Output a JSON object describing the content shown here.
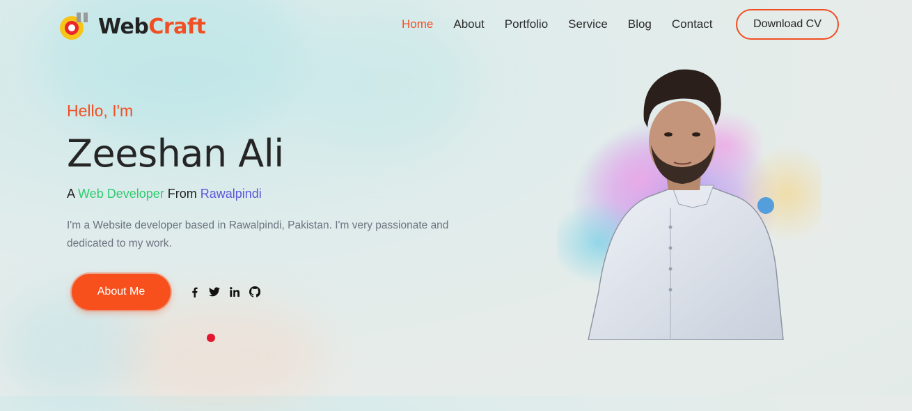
{
  "logo": {
    "text_web": "Web",
    "text_craft": "Craft",
    "icon": "webcraft-logo-icon"
  },
  "nav": {
    "items": [
      {
        "label": "Home",
        "active": true
      },
      {
        "label": "About",
        "active": false
      },
      {
        "label": "Portfolio",
        "active": false
      },
      {
        "label": "Service",
        "active": false
      },
      {
        "label": "Blog",
        "active": false
      },
      {
        "label": "Contact",
        "active": false
      }
    ],
    "cv_button": "Download CV"
  },
  "hero": {
    "greeting": "Hello, I'm",
    "name": "Zeeshan Ali",
    "role_prefix": "A ",
    "role_title": "Web Developer",
    "role_middle": " From ",
    "role_location": "Rawalpindi",
    "description": "I'm a Website developer based in Rawalpindi, Pakistan. I'm very passionate and dedicated to my work.",
    "about_button": "About Me"
  },
  "socials": [
    "facebook-icon",
    "twitter-icon",
    "linkedin-icon",
    "github-icon"
  ],
  "colors": {
    "accent": "#f04f23",
    "green": "#2fcb6f",
    "blue": "#5a57d8",
    "text": "#252525"
  }
}
